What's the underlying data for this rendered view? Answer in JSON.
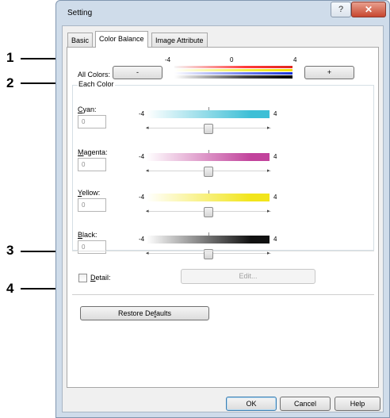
{
  "callouts": [
    "1",
    "2",
    "3",
    "4"
  ],
  "window": {
    "title": "Setting",
    "help_glyph": "?",
    "close_glyph": "✕"
  },
  "tabs": [
    {
      "label": "Basic",
      "active": false
    },
    {
      "label": "Color Balance",
      "active": true
    },
    {
      "label": "Image Attribute",
      "active": false
    }
  ],
  "all_colors": {
    "label": "All Colors:",
    "minus_label": "-",
    "plus_label": "+",
    "scale_min": "-4",
    "scale_mid": "0",
    "scale_max": "4"
  },
  "each_color": {
    "label": "Each Color",
    "channels": [
      {
        "label": "Cyan:",
        "mnemonic": "C",
        "rest": "yan:",
        "value": "0",
        "min": "-4",
        "max": "4",
        "color": "#3dbfd6",
        "slider_fraction": 0.5
      },
      {
        "label": "Magenta:",
        "mnemonic": "M",
        "rest": "agenta:",
        "value": "0",
        "min": "-4",
        "max": "4",
        "color": "#c2439c",
        "slider_fraction": 0.5
      },
      {
        "label": "Yellow:",
        "mnemonic": "Y",
        "rest": "ellow:",
        "value": "0",
        "min": "-4",
        "max": "4",
        "color": "#f2e51b",
        "slider_fraction": 0.5
      },
      {
        "label": "Black:",
        "mnemonic": "B",
        "rest": "lack:",
        "value": "0",
        "min": "-4",
        "max": "4",
        "color": "#111111",
        "slider_fraction": 0.5
      }
    ]
  },
  "detail": {
    "mnemonic": "D",
    "rest": "etail:",
    "checked": false,
    "edit_label": "Edit..."
  },
  "restore_label_pre": "Restore De",
  "restore_label_mn": "f",
  "restore_label_post": "aults",
  "footer": {
    "ok": "OK",
    "cancel": "Cancel",
    "help": "Help"
  },
  "arrows": {
    "left": "◂",
    "right": "▸"
  }
}
